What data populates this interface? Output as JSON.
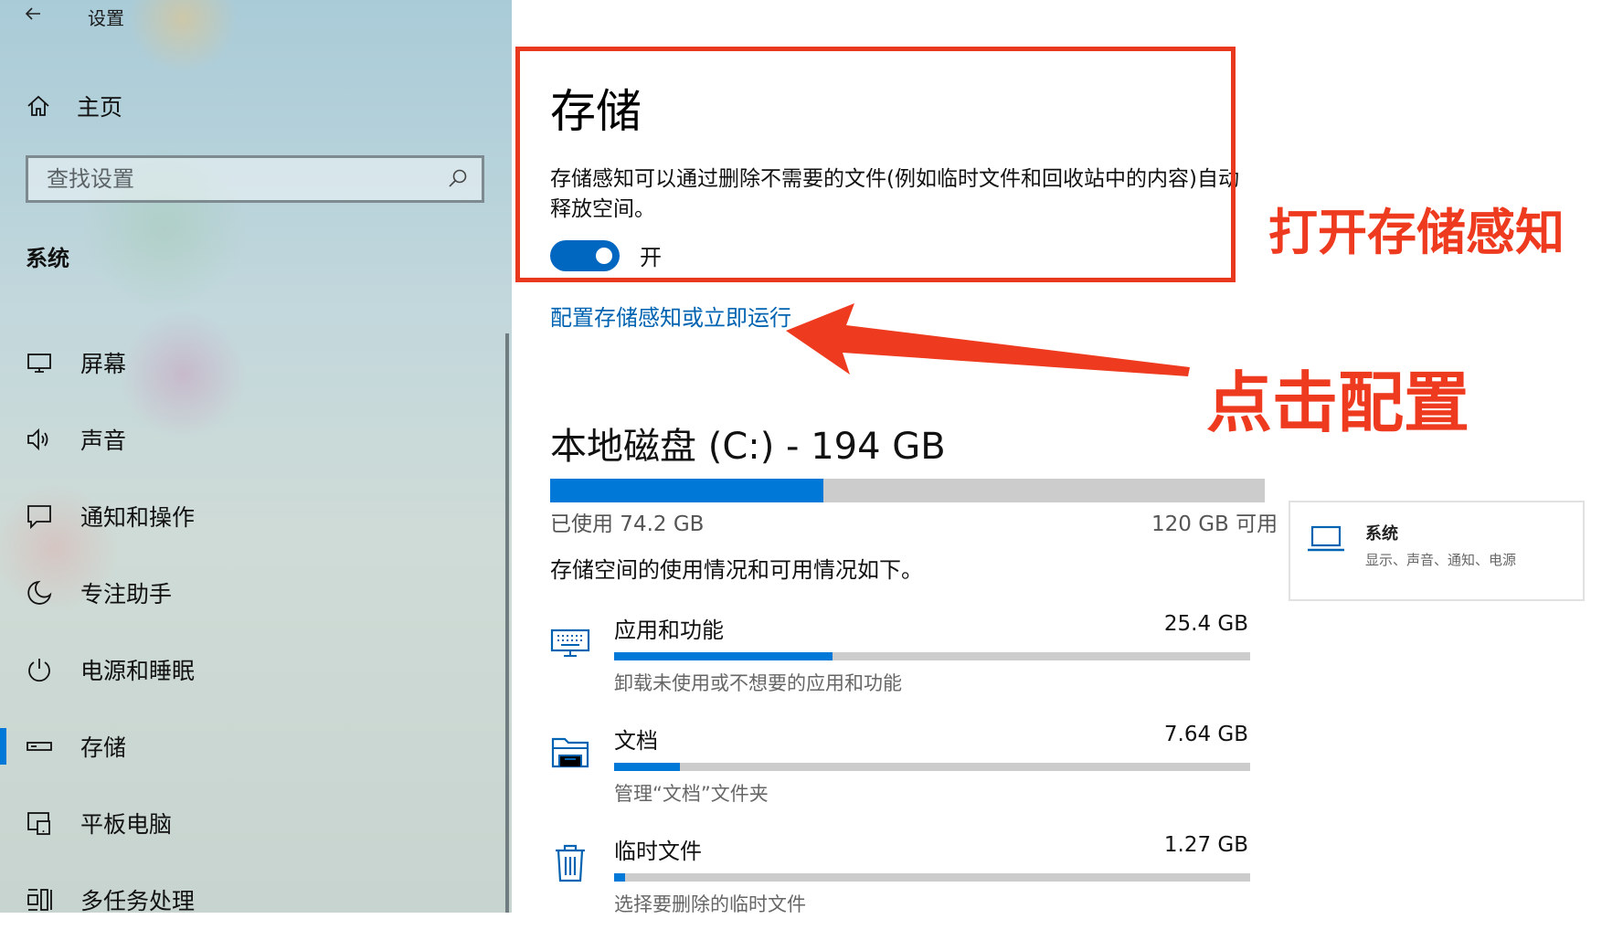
{
  "window": {
    "title": "设置"
  },
  "sidebar": {
    "home_label": "主页",
    "search_placeholder": "查找设置",
    "section_title": "系统",
    "items": [
      {
        "label": "屏幕",
        "icon": "monitor-icon"
      },
      {
        "label": "声音",
        "icon": "speaker-icon"
      },
      {
        "label": "通知和操作",
        "icon": "message-icon"
      },
      {
        "label": "专注助手",
        "icon": "moon-icon"
      },
      {
        "label": "电源和睡眠",
        "icon": "power-icon"
      },
      {
        "label": "存储",
        "icon": "storage-icon",
        "active": true
      },
      {
        "label": "平板电脑",
        "icon": "tablet-icon"
      },
      {
        "label": "多任务处理",
        "icon": "multitask-icon"
      }
    ]
  },
  "storage": {
    "title": "存储",
    "description": "存储感知可以通过删除不需要的文件(例如临时文件和回收站中的内容)自动释放空间。",
    "toggle_state": "开",
    "config_link": "配置存储感知或立即运行"
  },
  "disk": {
    "title": "本地磁盘 (C:) - 194 GB",
    "used_label": "已使用 74.2 GB",
    "free_label": "120 GB 可用",
    "used_fraction": 0.382,
    "usage_desc": "存储空间的使用情况和可用情况如下。",
    "categories": [
      {
        "name": "应用和功能",
        "size": "25.4 GB",
        "sub": "卸载未使用或不想要的应用和功能",
        "fraction": 0.343,
        "icon": "keyboard-icon"
      },
      {
        "name": "文档",
        "size": "7.64 GB",
        "sub": "管理“文档”文件夹",
        "fraction": 0.103,
        "icon": "folder-icon"
      },
      {
        "name": "临时文件",
        "size": "1.27 GB",
        "sub": "选择要删除的临时文件",
        "fraction": 0.017,
        "icon": "trash-icon"
      }
    ]
  },
  "annotations": {
    "open_label": "打开存储感知",
    "click_label": "点击配置",
    "color": "#ee3a1f"
  },
  "side_card": {
    "title": "系统",
    "subtitle": "显示、声音、通知、电源"
  },
  "colors": {
    "accent": "#0078d7",
    "link": "#0063b1",
    "bar_bg": "#cccccc"
  }
}
